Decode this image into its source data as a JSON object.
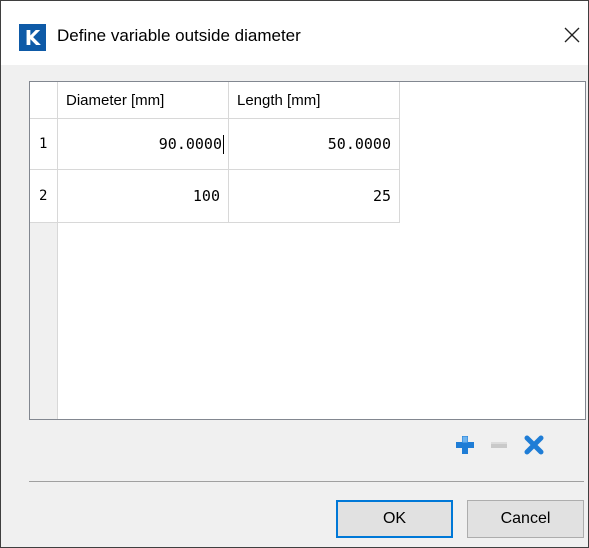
{
  "window": {
    "app_icon_letter": "K",
    "title": "Define variable outside diameter",
    "close_glyph": "✕"
  },
  "table": {
    "columns": [
      "Diameter [mm]",
      "Length [mm]"
    ],
    "rows": [
      {
        "index": "1",
        "diameter": "90.0000",
        "length": "50.0000"
      },
      {
        "index": "2",
        "diameter": "100",
        "length": "25"
      }
    ]
  },
  "toolbar": {
    "add_icon": "plus-icon",
    "remove_icon": "minus-icon",
    "clear_icon": "x-icon"
  },
  "buttons": {
    "ok_label": "OK",
    "cancel_label": "Cancel"
  },
  "colors": {
    "app_icon": "#0e5aa7",
    "add_icon": "#1f7dd6",
    "clear_icon": "#1f7dd6",
    "default_button_border": "#0078d7"
  }
}
